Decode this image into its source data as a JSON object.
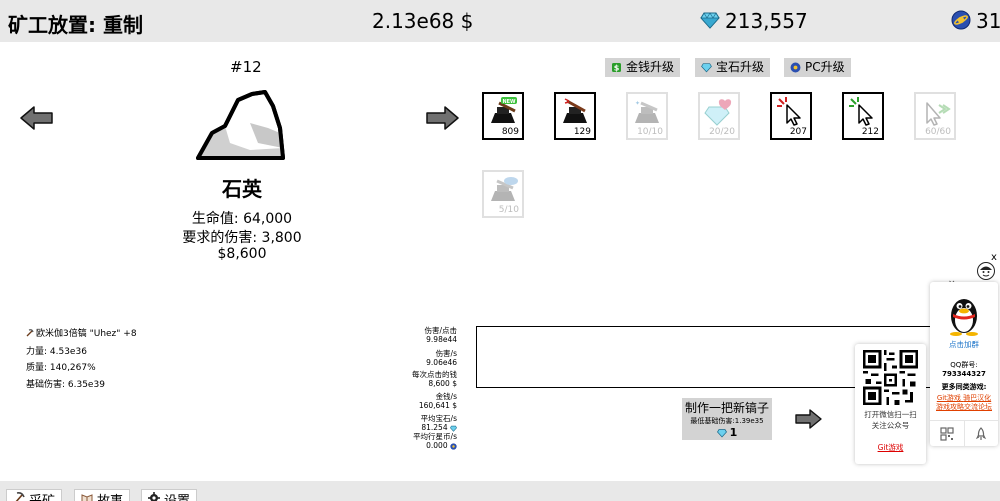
{
  "header": {
    "title": "矿工放置: 重制",
    "money": "2.13e68 $",
    "gems": "213,557",
    "pc": "31"
  },
  "mineral": {
    "number": "#12",
    "name": "石英",
    "hp": "生命值: 64,000",
    "required_damage": "要求的伤害: 3,800",
    "value": "$8,600"
  },
  "upgrade_tabs": [
    {
      "label": "金钱升级",
      "icon": "money-icon"
    },
    {
      "label": "宝石升级",
      "icon": "gem-icon"
    },
    {
      "label": "PC升级",
      "icon": "pc-coin-icon"
    }
  ],
  "upgrades": [
    {
      "icon": "pickaxe-new-icon",
      "count": "809"
    },
    {
      "icon": "pickaxe-red-icon",
      "count": "129"
    },
    {
      "icon": "pickaxe-sparkle-icon",
      "count": "10/10"
    },
    {
      "icon": "diamond-heart-icon",
      "count": "20/20"
    },
    {
      "icon": "cursor-red-icon",
      "count": "207"
    },
    {
      "icon": "cursor-green-icon",
      "count": "212"
    },
    {
      "icon": "cursor-arrows-icon",
      "count": "60/60"
    },
    {
      "icon": "pickaxe-cloud-icon",
      "count": "5/10"
    }
  ],
  "pickaxe": {
    "name": "欧米伽3倍镐 \"Uhez\" +8",
    "power": "力量: 4.53e36",
    "quality": "质量: 140,267%",
    "base_damage": "基础伤害: 6.35e39"
  },
  "stats": [
    {
      "label": "伤害/点击",
      "value": "9.98e44"
    },
    {
      "label": "伤害/s",
      "value": "9.06e46"
    },
    {
      "label": "每次点击的钱",
      "value": "8,600 $"
    },
    {
      "label": "金钱/s",
      "value": "160,641 $"
    },
    {
      "label": "平均宝石/s",
      "value": "81.254"
    },
    {
      "label": "平均行星币/s",
      "value": "0.000"
    }
  ],
  "craft": {
    "title": "制作一把新镐子",
    "min_damage": "最低基础伤害:1.39e35",
    "cost": "1"
  },
  "qr_popup": {
    "line1": "打开微信扫一扫",
    "line2": "关注公众号",
    "link": "Git游戏"
  },
  "qq_panel": {
    "close": "×",
    "join": "点击加群",
    "group_label": "QQ群号:",
    "group_number": "793344327",
    "more_games": "更多同类游戏:",
    "links": [
      "Git游戏",
      "骑巴汉化",
      "游戏攻略交流论坛"
    ]
  },
  "bottom_tabs": [
    {
      "label": "采矿"
    },
    {
      "label": "故事"
    },
    {
      "label": "设置"
    }
  ],
  "colors": {
    "bar": "#e8e8e8",
    "tab": "#d3d3d3",
    "gem": "#4fb8d8",
    "money_green": "#2a9d2a",
    "link_red": "#d00000",
    "qq_blue": "#1a73c8"
  }
}
